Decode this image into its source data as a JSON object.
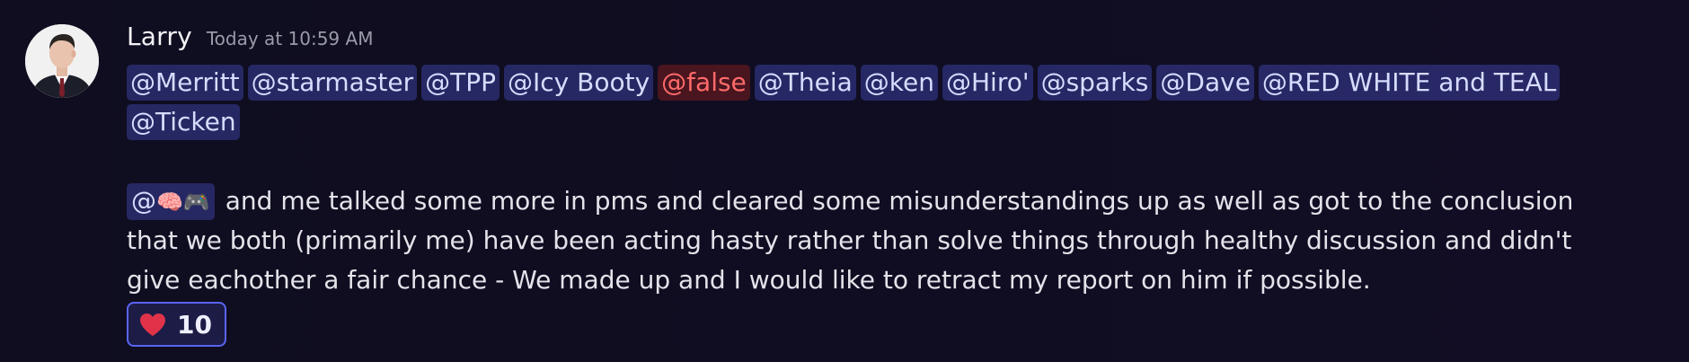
{
  "message": {
    "username": "Larry",
    "timestamp": "Today at 10:59 AM",
    "mentions": [
      {
        "text": "@Merritt",
        "style": "normal"
      },
      {
        "text": "@starmaster",
        "style": "normal"
      },
      {
        "text": "@TPP",
        "style": "normal"
      },
      {
        "text": "@Icy Booty",
        "style": "normal"
      },
      {
        "text": "@false",
        "style": "red"
      },
      {
        "text": "@Theia",
        "style": "normal"
      },
      {
        "text": "@ken",
        "style": "normal"
      },
      {
        "text": "@Hiro'",
        "style": "normal"
      },
      {
        "text": "@sparks",
        "style": "normal"
      },
      {
        "text": "@Dave",
        "style": "normal"
      },
      {
        "text": "@RED WHITE and TEAL",
        "style": "normal"
      },
      {
        "text": "@Ticken",
        "style": "normal"
      }
    ],
    "inline_mention": {
      "at": "@",
      "emoji": "🧠🎮"
    },
    "body": "and me talked some more in pms and cleared some misunderstandings up as well as got to the conclusion that we both (primarily me) have been acting hasty rather than solve things through healthy discussion and didn't give eachother a fair chance - We made up and I would like to retract my report on him if possible.",
    "reaction": {
      "icon": "heart-icon",
      "count": "10"
    }
  },
  "colors": {
    "mention_bg": "#3a3f8a",
    "mention_text": "#d7dcff",
    "mention_red_text": "#ff6a6a",
    "reaction_border": "#5865f2",
    "heart": "#e0334a"
  }
}
